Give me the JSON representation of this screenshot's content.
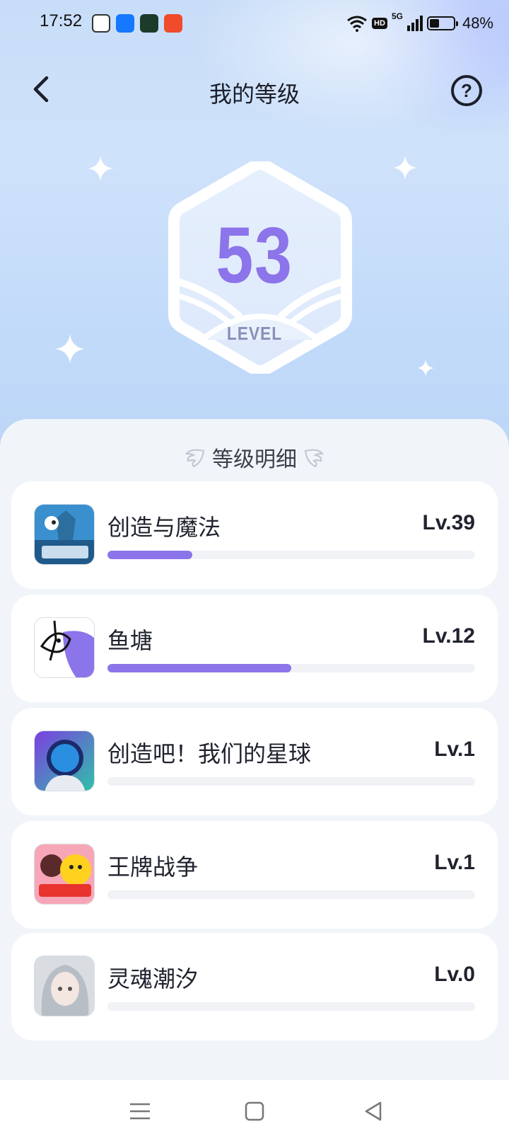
{
  "status_bar": {
    "time": "17:52",
    "network": "5G",
    "hd": "HD",
    "battery_percent_text": "48%",
    "battery_level": 0.48,
    "notification_icons": [
      "game-center-icon",
      "alipay-icon",
      "green-app-icon",
      "video-app-icon"
    ]
  },
  "header": {
    "title": "我的等级",
    "back_icon": "chevron-left-icon",
    "help_icon": "question-circle-icon",
    "help_glyph": "?"
  },
  "level_badge": {
    "number": "53",
    "label": "LEVEL"
  },
  "details": {
    "section_title": "等级明细",
    "games": [
      {
        "name": "创造与魔法",
        "level": "Lv.39",
        "progress": 0.23,
        "icon": "creation-magic-game-icon"
      },
      {
        "name": "鱼塘",
        "level": "Lv.12",
        "progress": 0.5,
        "icon": "fish-pond-game-icon"
      },
      {
        "name": "创造吧！我们的星球",
        "level": "Lv.1",
        "progress": 0,
        "icon": "astronaut-game-icon"
      },
      {
        "name": "王牌战争",
        "level": "Lv.1",
        "progress": 0,
        "icon": "ace-war-game-icon"
      },
      {
        "name": "灵魂潮汐",
        "level": "Lv.0",
        "progress": 0,
        "icon": "soul-tide-game-icon"
      }
    ]
  },
  "nav_bar": {
    "icons": [
      "menu-icon",
      "home-icon",
      "back-triangle-icon"
    ]
  },
  "colors": {
    "accent": "#8c74ea",
    "level_label": "#8790b8",
    "background": "#f1f5f9"
  }
}
